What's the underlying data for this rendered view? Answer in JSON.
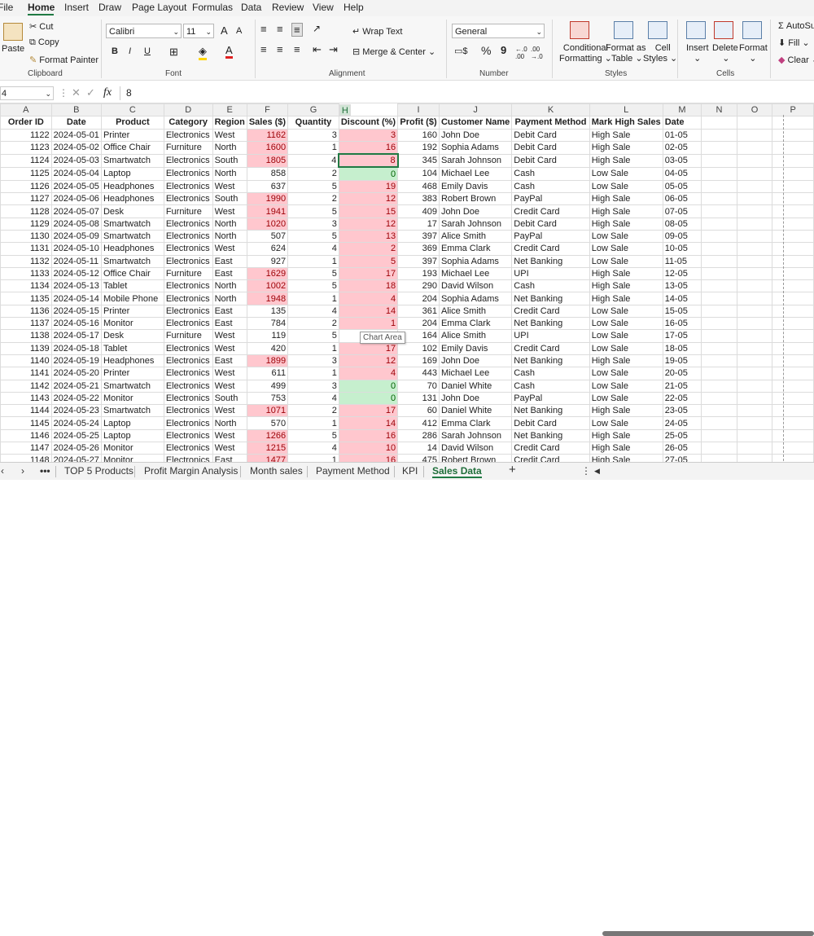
{
  "menu": [
    "File",
    "Home",
    "Insert",
    "Draw",
    "Page Layout",
    "Formulas",
    "Data",
    "Review",
    "View",
    "Help"
  ],
  "ribbon": {
    "clipboard": {
      "paste": "Paste",
      "cut": "Cut",
      "copy": "Copy",
      "format_painter": "Format Painter",
      "label": "Clipboard"
    },
    "font": {
      "name": "Calibri",
      "size": "11",
      "grow": "A",
      "shrink": "A",
      "bold": "B",
      "italic": "I",
      "underline": "U",
      "label": "Font"
    },
    "alignment": {
      "wrap": "Wrap Text",
      "merge": "Merge & Center",
      "label": "Alignment"
    },
    "number": {
      "format": "General",
      "currency": "$",
      "percent": "%",
      "comma": "9",
      "inc": "←.0 .00",
      "dec": ".00 →.0",
      "label": "Number"
    },
    "styles": {
      "conditional": "Conditional",
      "conditional2": "Formatting",
      "format_table": "Format as",
      "format_table2": "Table",
      "cell_styles": "Cell",
      "cell_styles2": "Styles",
      "label": "Styles"
    },
    "cells": {
      "insert": "Insert",
      "delete": "Delete",
      "format": "Format",
      "label": "Cells"
    },
    "editing": {
      "autosum": "AutoSu",
      "fill": "Fill",
      "clear": "Clear"
    }
  },
  "formula_bar": {
    "name_box": "4",
    "fx": "fx",
    "value": "8"
  },
  "columns": [
    "A",
    "B",
    "C",
    "D",
    "E",
    "F",
    "G",
    "H",
    "I",
    "J",
    "K",
    "L",
    "M",
    "N",
    "O",
    "P"
  ],
  "headers": [
    "Order ID",
    "Date",
    "Product",
    "Category",
    "Region",
    "Sales ($)",
    "Quantity",
    "Discount (%)",
    "Profit ($)",
    "Customer Name",
    "Payment Method",
    "Mark High Sales",
    "Date"
  ],
  "rows": [
    [
      "1122",
      "2024-05-01",
      "Printer",
      "Electronics",
      "West",
      "1162",
      "3",
      "3",
      "160",
      "John Doe",
      "Debit Card",
      "High Sale",
      "01-05"
    ],
    [
      "1123",
      "2024-05-02",
      "Office Chair",
      "Furniture",
      "North",
      "1600",
      "1",
      "16",
      "192",
      "Sophia Adams",
      "Debit Card",
      "High Sale",
      "02-05"
    ],
    [
      "1124",
      "2024-05-03",
      "Smartwatch",
      "Electronics",
      "South",
      "1805",
      "4",
      "8",
      "345",
      "Sarah Johnson",
      "Debit Card",
      "High Sale",
      "03-05"
    ],
    [
      "1125",
      "2024-05-04",
      "Laptop",
      "Electronics",
      "North",
      "858",
      "2",
      "0",
      "104",
      "Michael Lee",
      "Cash",
      "Low Sale",
      "04-05"
    ],
    [
      "1126",
      "2024-05-05",
      "Headphones",
      "Electronics",
      "West",
      "637",
      "5",
      "19",
      "468",
      "Emily Davis",
      "Cash",
      "Low Sale",
      "05-05"
    ],
    [
      "1127",
      "2024-05-06",
      "Headphones",
      "Electronics",
      "South",
      "1990",
      "2",
      "12",
      "383",
      "Robert Brown",
      "PayPal",
      "High Sale",
      "06-05"
    ],
    [
      "1128",
      "2024-05-07",
      "Desk",
      "Furniture",
      "West",
      "1941",
      "5",
      "15",
      "409",
      "John Doe",
      "Credit Card",
      "High Sale",
      "07-05"
    ],
    [
      "1129",
      "2024-05-08",
      "Smartwatch",
      "Electronics",
      "North",
      "1020",
      "3",
      "12",
      "17",
      "Sarah Johnson",
      "Debit Card",
      "High Sale",
      "08-05"
    ],
    [
      "1130",
      "2024-05-09",
      "Smartwatch",
      "Electronics",
      "North",
      "507",
      "5",
      "13",
      "397",
      "Alice Smith",
      "PayPal",
      "Low Sale",
      "09-05"
    ],
    [
      "1131",
      "2024-05-10",
      "Headphones",
      "Electronics",
      "West",
      "624",
      "4",
      "2",
      "369",
      "Emma Clark",
      "Credit Card",
      "Low Sale",
      "10-05"
    ],
    [
      "1132",
      "2024-05-11",
      "Smartwatch",
      "Electronics",
      "East",
      "927",
      "1",
      "5",
      "397",
      "Sophia Adams",
      "Net Banking",
      "Low Sale",
      "11-05"
    ],
    [
      "1133",
      "2024-05-12",
      "Office Chair",
      "Furniture",
      "East",
      "1629",
      "5",
      "17",
      "193",
      "Michael Lee",
      "UPI",
      "High Sale",
      "12-05"
    ],
    [
      "1134",
      "2024-05-13",
      "Tablet",
      "Electronics",
      "North",
      "1002",
      "5",
      "18",
      "290",
      "David Wilson",
      "Cash",
      "High Sale",
      "13-05"
    ],
    [
      "1135",
      "2024-05-14",
      "Mobile Phone",
      "Electronics",
      "North",
      "1948",
      "1",
      "4",
      "204",
      "Sophia Adams",
      "Net Banking",
      "High Sale",
      "14-05"
    ],
    [
      "1136",
      "2024-05-15",
      "Printer",
      "Electronics",
      "East",
      "135",
      "4",
      "14",
      "361",
      "Alice Smith",
      "Credit Card",
      "Low Sale",
      "15-05"
    ],
    [
      "1137",
      "2024-05-16",
      "Monitor",
      "Electronics",
      "East",
      "784",
      "2",
      "1",
      "204",
      "Emma Clark",
      "Net Banking",
      "Low Sale",
      "16-05"
    ],
    [
      "1138",
      "2024-05-17",
      "Desk",
      "Furniture",
      "West",
      "119",
      "5",
      "",
      "164",
      "Alice Smith",
      "UPI",
      "Low Sale",
      "17-05"
    ],
    [
      "1139",
      "2024-05-18",
      "Tablet",
      "Electronics",
      "West",
      "420",
      "1",
      "17",
      "102",
      "Emily Davis",
      "Credit Card",
      "Low Sale",
      "18-05"
    ],
    [
      "1140",
      "2024-05-19",
      "Headphones",
      "Electronics",
      "East",
      "1899",
      "3",
      "12",
      "169",
      "John Doe",
      "Net Banking",
      "High Sale",
      "19-05"
    ],
    [
      "1141",
      "2024-05-20",
      "Printer",
      "Electronics",
      "West",
      "611",
      "1",
      "4",
      "443",
      "Michael Lee",
      "Cash",
      "Low Sale",
      "20-05"
    ],
    [
      "1142",
      "2024-05-21",
      "Smartwatch",
      "Electronics",
      "West",
      "499",
      "3",
      "0",
      "70",
      "Daniel White",
      "Cash",
      "Low Sale",
      "21-05"
    ],
    [
      "1143",
      "2024-05-22",
      "Monitor",
      "Electronics",
      "South",
      "753",
      "4",
      "0",
      "131",
      "John Doe",
      "PayPal",
      "Low Sale",
      "22-05"
    ],
    [
      "1144",
      "2024-05-23",
      "Smartwatch",
      "Electronics",
      "West",
      "1071",
      "2",
      "17",
      "60",
      "Daniel White",
      "Net Banking",
      "High Sale",
      "23-05"
    ],
    [
      "1145",
      "2024-05-24",
      "Laptop",
      "Electronics",
      "North",
      "570",
      "1",
      "14",
      "412",
      "Emma Clark",
      "Debit Card",
      "Low Sale",
      "24-05"
    ],
    [
      "1146",
      "2024-05-25",
      "Laptop",
      "Electronics",
      "West",
      "1266",
      "5",
      "16",
      "286",
      "Sarah Johnson",
      "Net Banking",
      "High Sale",
      "25-05"
    ],
    [
      "1147",
      "2024-05-26",
      "Monitor",
      "Electronics",
      "West",
      "1215",
      "4",
      "10",
      "14",
      "David Wilson",
      "Credit Card",
      "High Sale",
      "26-05"
    ]
  ],
  "partial_row": [
    "1148",
    "2024-05-27",
    "Monitor",
    "Electronics",
    "East",
    "1477",
    "1",
    "16",
    "475",
    "Robert Brown",
    "Credit Card",
    "High Sale",
    "27-05"
  ],
  "tooltip": "Chart Area",
  "sheet_tabs": [
    "TOP 5 Products",
    "Profit Margin Analysis",
    "Month sales",
    "Payment Method",
    "KPI",
    "Sales Data"
  ],
  "active_tab": "Sales Data",
  "colors": {
    "red_fill": "#ffc7ce",
    "red_text": "#9c0006",
    "green_fill": "#c6efce",
    "green_text": "#006100",
    "accent": "#1f7a43"
  }
}
